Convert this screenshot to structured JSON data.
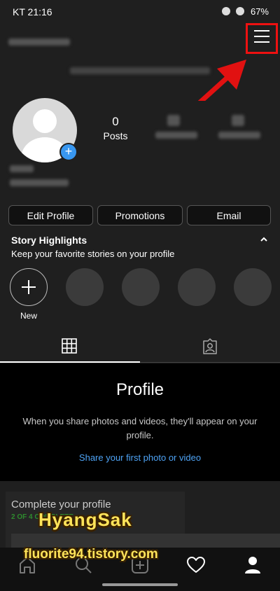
{
  "status_bar": {
    "time": "KT 21:16",
    "battery": "67%"
  },
  "profile": {
    "posts_count": "0",
    "posts_label": "Posts"
  },
  "buttons": {
    "edit_profile": "Edit Profile",
    "promotions": "Promotions",
    "email": "Email"
  },
  "highlights": {
    "title": "Story Highlights",
    "subtitle": "Keep your favorite stories on your profile",
    "new_label": "New"
  },
  "empty_state": {
    "title": "Profile",
    "description": "When you share photos and videos, they'll appear on your profile.",
    "link": "Share your first photo or video"
  },
  "complete_profile": {
    "title": "Complete your profile",
    "progress": "2 OF 4 COMPLETE"
  },
  "watermark": {
    "name": "HyangSak",
    "url": "fluorite94.tistory.com"
  },
  "icons": {
    "menu": "hamburger-menu-icon",
    "grid": "grid-icon",
    "tagged": "tagged-icon",
    "home": "home-icon",
    "search": "search-icon",
    "add": "add-post-icon",
    "heart": "heart-icon",
    "profile": "profile-icon"
  },
  "colors": {
    "accent": "#3897f0",
    "link": "#4ea3f5",
    "annotation": "#e11111"
  }
}
